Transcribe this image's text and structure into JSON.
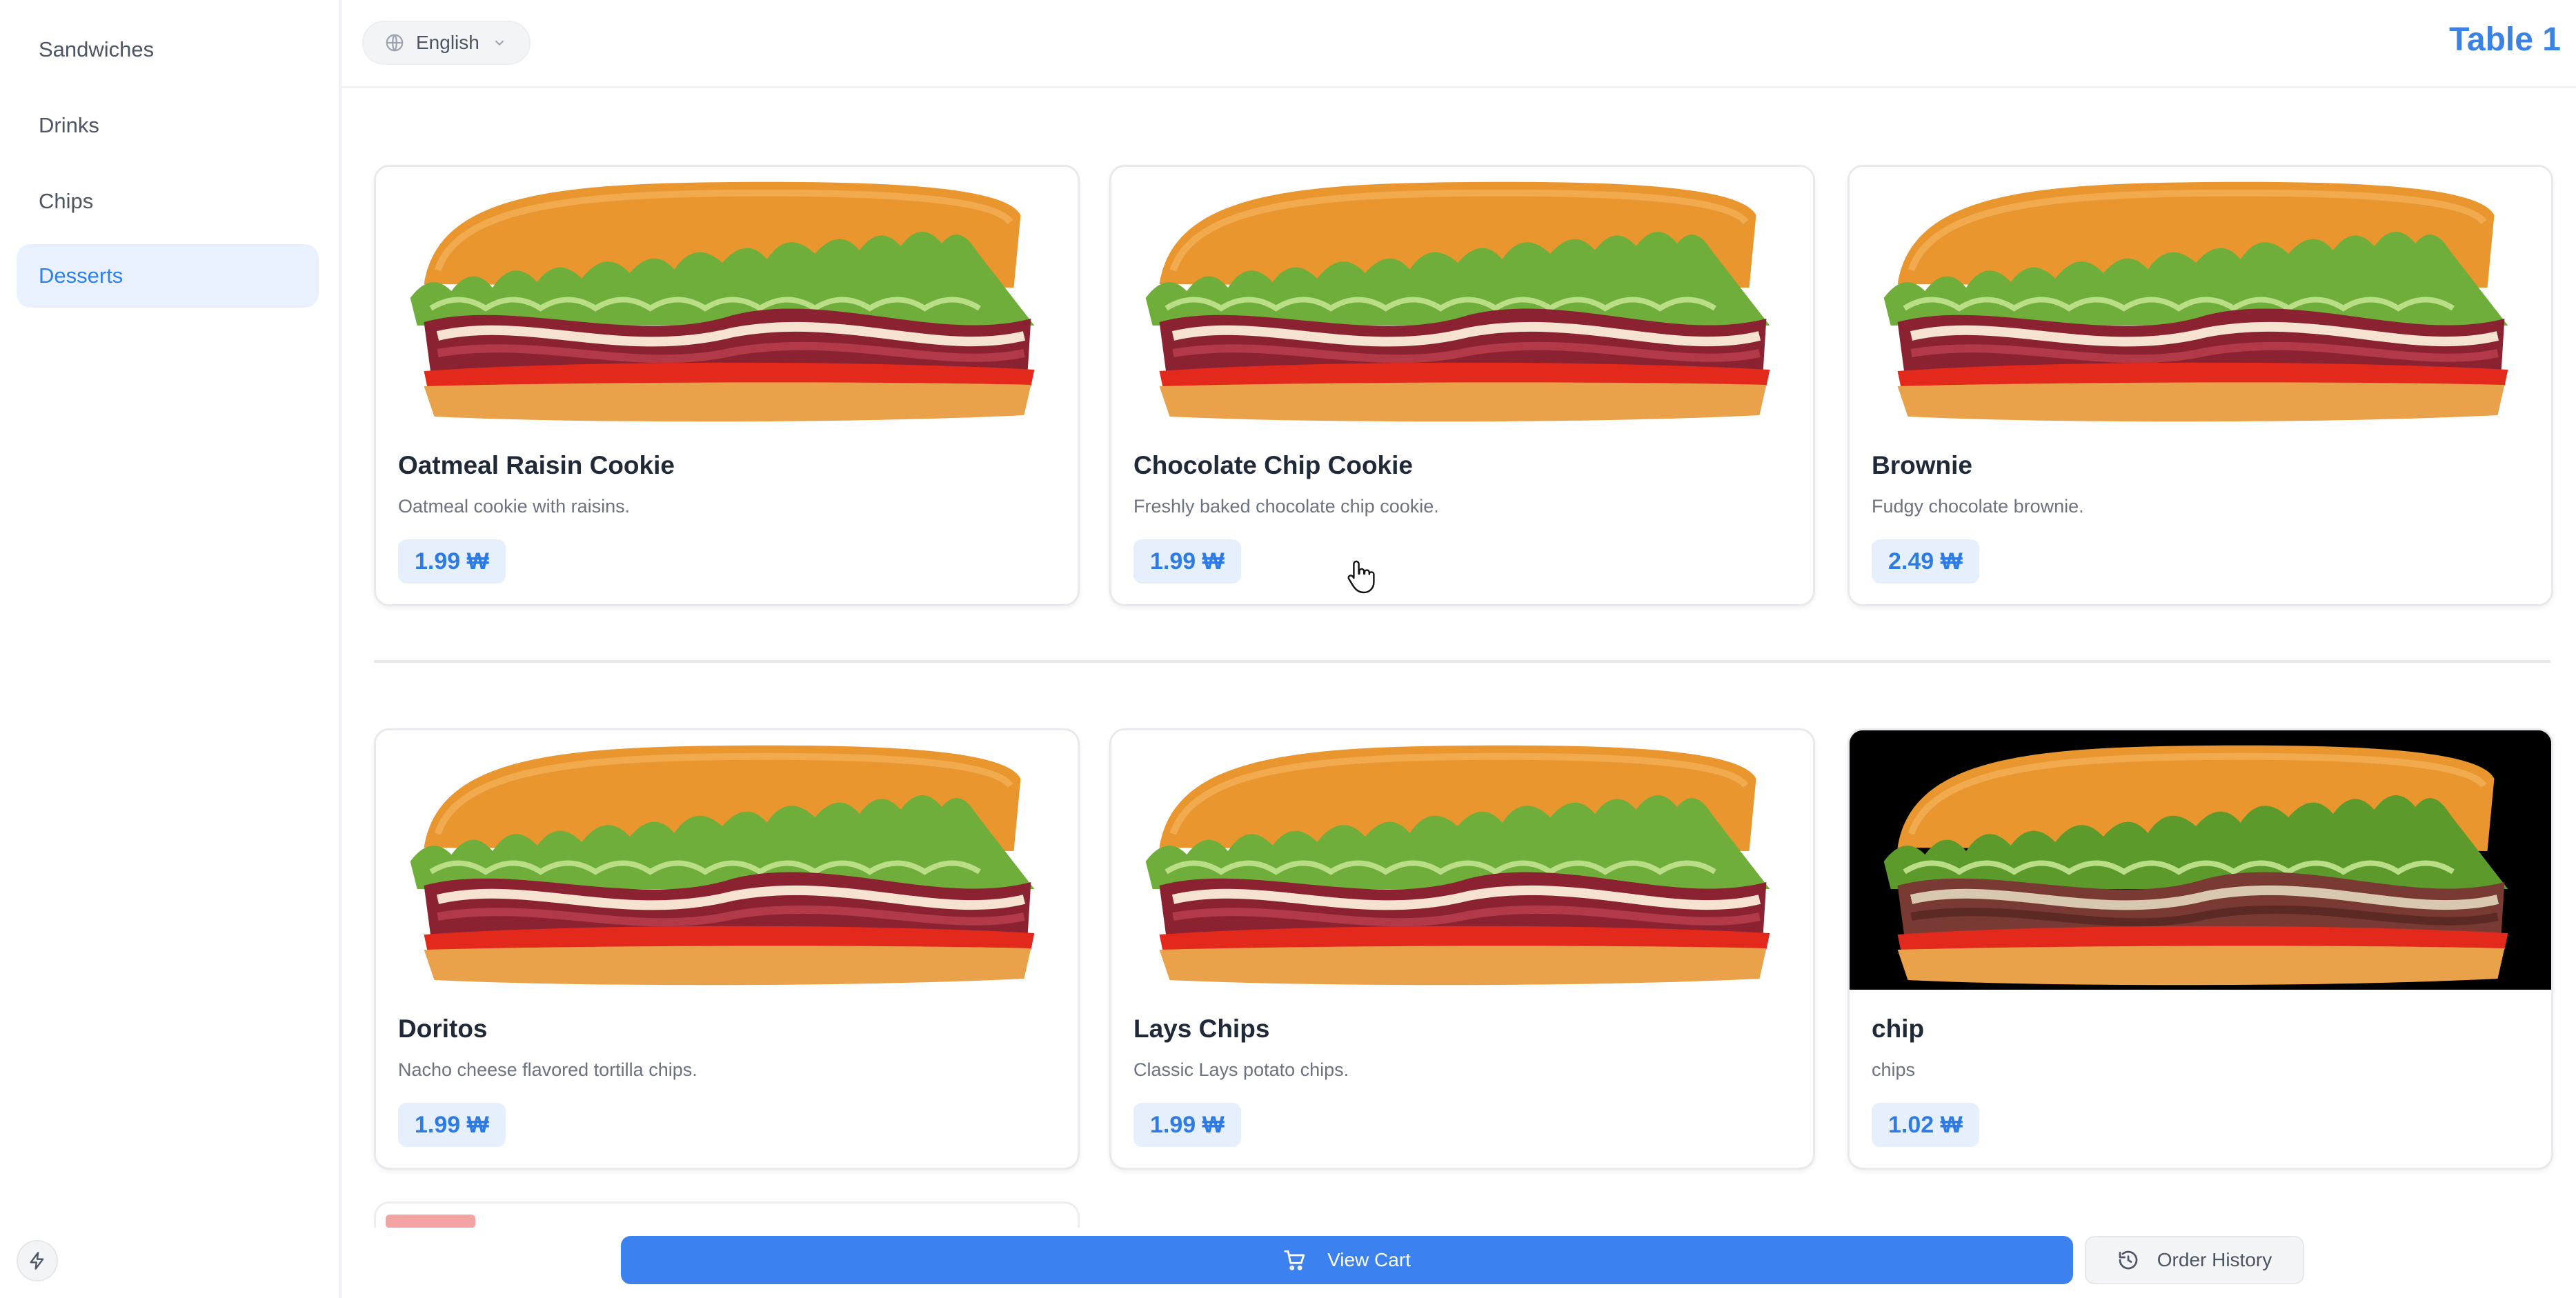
{
  "sidebar": {
    "items": [
      {
        "label": "Sandwiches",
        "active": false
      },
      {
        "label": "Drinks",
        "active": false
      },
      {
        "label": "Chips",
        "active": false
      },
      {
        "label": "Desserts",
        "active": true
      }
    ],
    "bolt_icon": "bolt-icon"
  },
  "header": {
    "language": "English",
    "table": "Table 1"
  },
  "products": [
    {
      "name": "Oatmeal Raisin Cookie",
      "description": "Oatmeal cookie with raisins.",
      "price": "1.99 ₩",
      "image": "sandwich"
    },
    {
      "name": "Chocolate Chip Cookie",
      "description": "Freshly baked chocolate chip cookie.",
      "price": "1.99 ₩",
      "image": "sandwich"
    },
    {
      "name": "Brownie",
      "description": "Fudgy chocolate brownie.",
      "price": "2.49 ₩",
      "image": "sandwich"
    },
    {
      "name": "Doritos",
      "description": "Nacho cheese flavored tortilla chips.",
      "price": "1.99 ₩",
      "image": "sandwich"
    },
    {
      "name": "Lays Chips",
      "description": "Classic Lays potato chips.",
      "price": "1.99 ₩",
      "image": "sandwich"
    },
    {
      "name": "chip",
      "description": "chips",
      "price": "1.02 ₩",
      "image": "roast-beef-sandwich-dark"
    }
  ],
  "footer": {
    "cart_label": "View Cart",
    "history_label": "Order History"
  },
  "colors": {
    "accent": "#3b82f0",
    "active_bg": "#e8f1fd",
    "price_bg": "#e6f0fd"
  }
}
